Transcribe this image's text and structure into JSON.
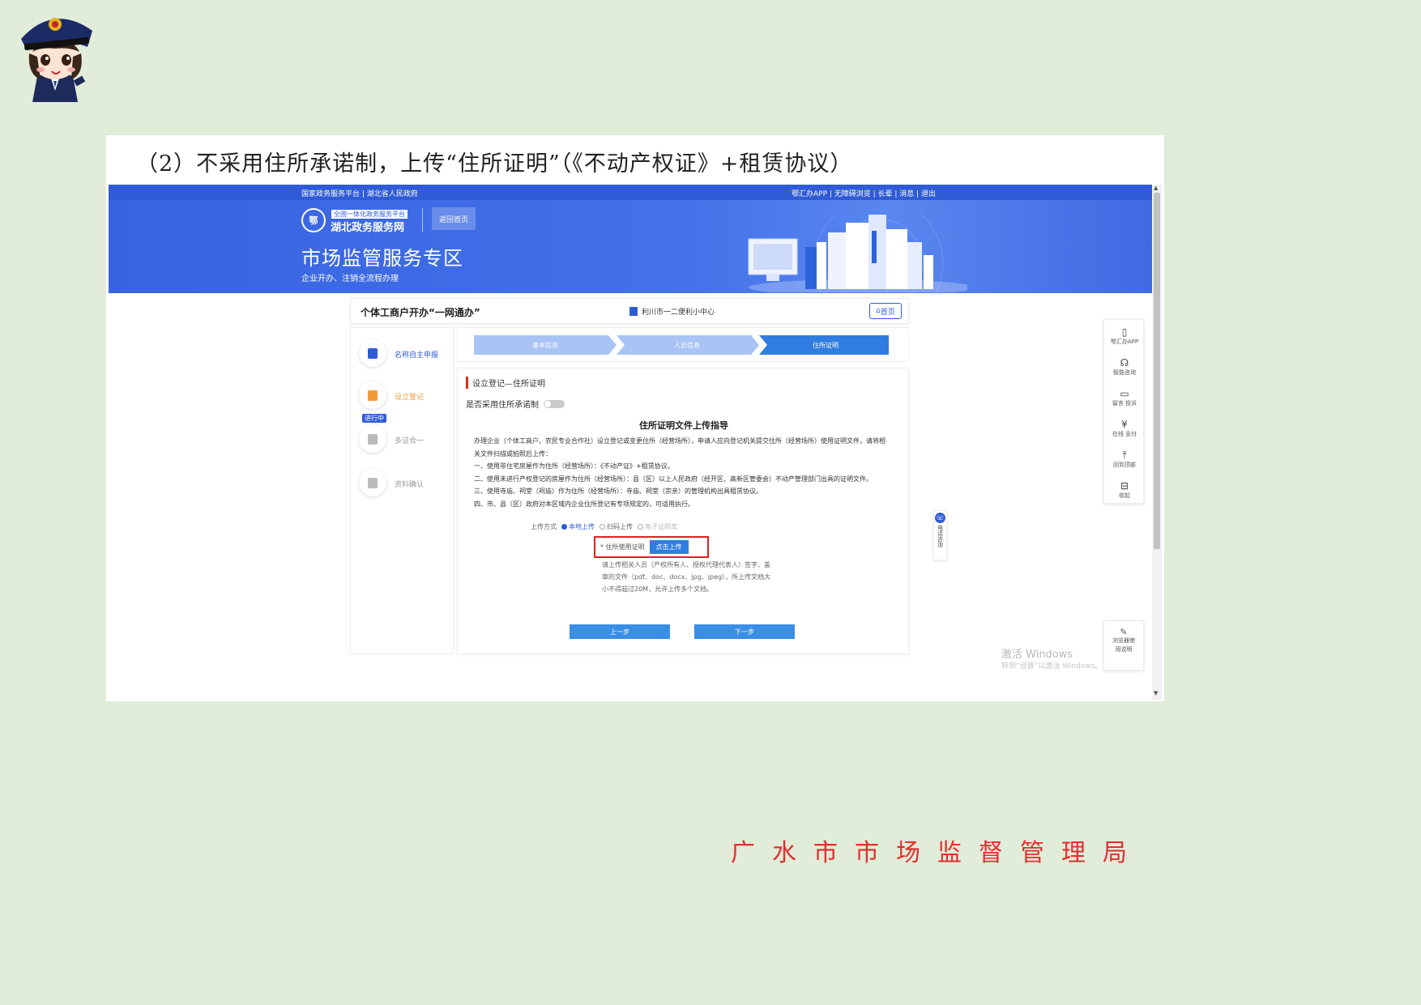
{
  "caption": "（2）不采用住所承诺制，上传“住所证明”（《不动产权证》+租赁协议）",
  "topbar": {
    "left": "国家政务服务平台 | 湖北省人民政府",
    "right": "鄂汇办APP | 无障碍浏览 | 长辈 | 消息 | 退出"
  },
  "banner": {
    "logo_badge": "鄂",
    "logo_small": "全国一体化政务服务平台",
    "logo_big": "湖北政务服务网",
    "back_home": "返回首页",
    "title": "市场监管服务专区",
    "subtitle": "企业开办、注销全流程办理"
  },
  "header": {
    "title": "个体工商户开办“一网通办”",
    "center": "利川市一二便利小中心",
    "home_btn": "首页"
  },
  "steps": [
    {
      "label": "名称自主申报",
      "color": "#2f5bd6",
      "badge": ""
    },
    {
      "label": "设立登记",
      "color": "#f29b38",
      "badge": "进行中"
    },
    {
      "label": "多证合一",
      "color": "#bbbbbb",
      "badge": ""
    },
    {
      "label": "资料确认",
      "color": "#bbbbbb",
      "badge": ""
    }
  ],
  "progress": [
    "基本信息",
    "人员信息",
    "住所证明"
  ],
  "form": {
    "section_title": "设立登记—住所证明",
    "toggle_label": "是否采用住所承诺制",
    "guide_title": "住所证明文件上传指导",
    "guide_lines": [
      "    办理企业（个体工商户、农民专业合作社）设立登记或变更住所（经营场所），申请人应向登记机关提交住所（经营场所）使用证明文件，请将相关文件扫描或拍照后上传：",
      "    一、使用非住宅房屋作为住所（经营场所）：《不动产证》+租赁协议。",
      "    二、使用未进行产权登记的房屋作为住所（经营场所）：县（区）以上人民政府（经开区、高新区管委会）不动产管理部门出具的证明文件。",
      "    三、使用寺庙、祠堂（祠庙）作为住所（经营场所）：寺庙、祠堂（宗亲）的管理机构出具租赁协议。",
      "    四、市、县（区）政府对本区域内企业住所登记有专项规定的，可适用执行。"
    ],
    "upload_mode_label": "上传方式",
    "upload_modes": [
      "本地上传",
      "扫码上传",
      "电子证照库"
    ],
    "upload_label": "* 住所使用证明",
    "upload_btn": "点击上传",
    "upload_note": "请上传相关人员（产权所有人、授权代理代表人）签字、盖章的文件（pdf、doc、docx、jpg、jpeg），所上传文档大小不得超过20M，允许上传多个文档。",
    "prev_btn": "上一步",
    "next_btn": "下一步"
  },
  "float_bar": [
    "鄂汇办APP",
    "智能咨询",
    "留言 投诉",
    "在线 支付",
    "回到顶部",
    "收起"
  ],
  "consult": "电话咨询",
  "browser_guide": "浏览器使用说明",
  "watermark": {
    "line1": "激活 Windows",
    "line2": "转到“设置”以激活 Windows。"
  },
  "footer": "广水市市场监督管理局"
}
